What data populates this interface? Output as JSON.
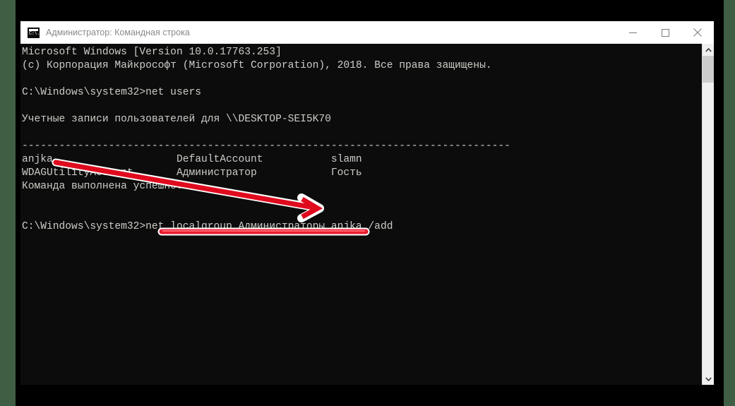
{
  "window": {
    "title": "Администратор: Командная строка",
    "icon": "console-icon",
    "controls": [
      {
        "name": "minimize-button",
        "glyph": "minimize"
      },
      {
        "name": "maximize-button",
        "glyph": "maximize"
      },
      {
        "name": "close-button",
        "glyph": "close"
      }
    ]
  },
  "console": {
    "lines": [
      "Microsoft Windows [Version 10.0.17763.253]",
      "(c) Корпорация Майкрософт (Microsoft Corporation), 2018. Все права защищены.",
      "",
      "C:\\Windows\\system32>net users",
      "",
      "Учетные записи пользователей для \\\\DESKTOP-SEI5K70",
      "",
      "-------------------------------------------------------------------------------",
      "anjka                    DefaultAccount           slamn",
      "WDAGUtilityAccount       Администратор            Гость",
      "Команда выполнена успешно.",
      "",
      "",
      "C:\\Windows\\system32>net localgroup Администраторы anjka /add"
    ],
    "text_color": "#ccccc7",
    "background_color": "#0c0c0c",
    "prompt_path": "C:\\Windows\\system32",
    "command_1": "net users",
    "command_2": "net localgroup Администраторы anjka /add",
    "host": "\\\\DESKTOP-SEI5K70",
    "users": [
      "anjka",
      "DefaultAccount",
      "slamn",
      "WDAGUtilityAccount",
      "Администратор",
      "Гость"
    ],
    "result_message": "Команда выполнена успешно.",
    "version_line": "Microsoft Windows [Version 10.0.17763.253]",
    "copyright_line": "(c) Корпорация Майкрософт (Microsoft Corporation), 2018. Все права защищены."
  },
  "annotations": {
    "accent_color": "#e8192c",
    "highlight_color": "#ff5f6b",
    "outline_color": "#ffffff",
    "arrow": {
      "name": "red-arrow",
      "from_label": "anjka",
      "to_label": "anjka in net localgroup command"
    },
    "underline": {
      "name": "red-underline-bar",
      "target": "net localgroup Администраторы anjka /add"
    }
  },
  "scrollbar": {
    "up_arrow": "scroll-up-arrow",
    "down_arrow": "scroll-down-arrow",
    "thumb": "scrollbar-thumb"
  },
  "desktop": {
    "background_color": "#3f5e44",
    "matte_color": "#000000"
  }
}
